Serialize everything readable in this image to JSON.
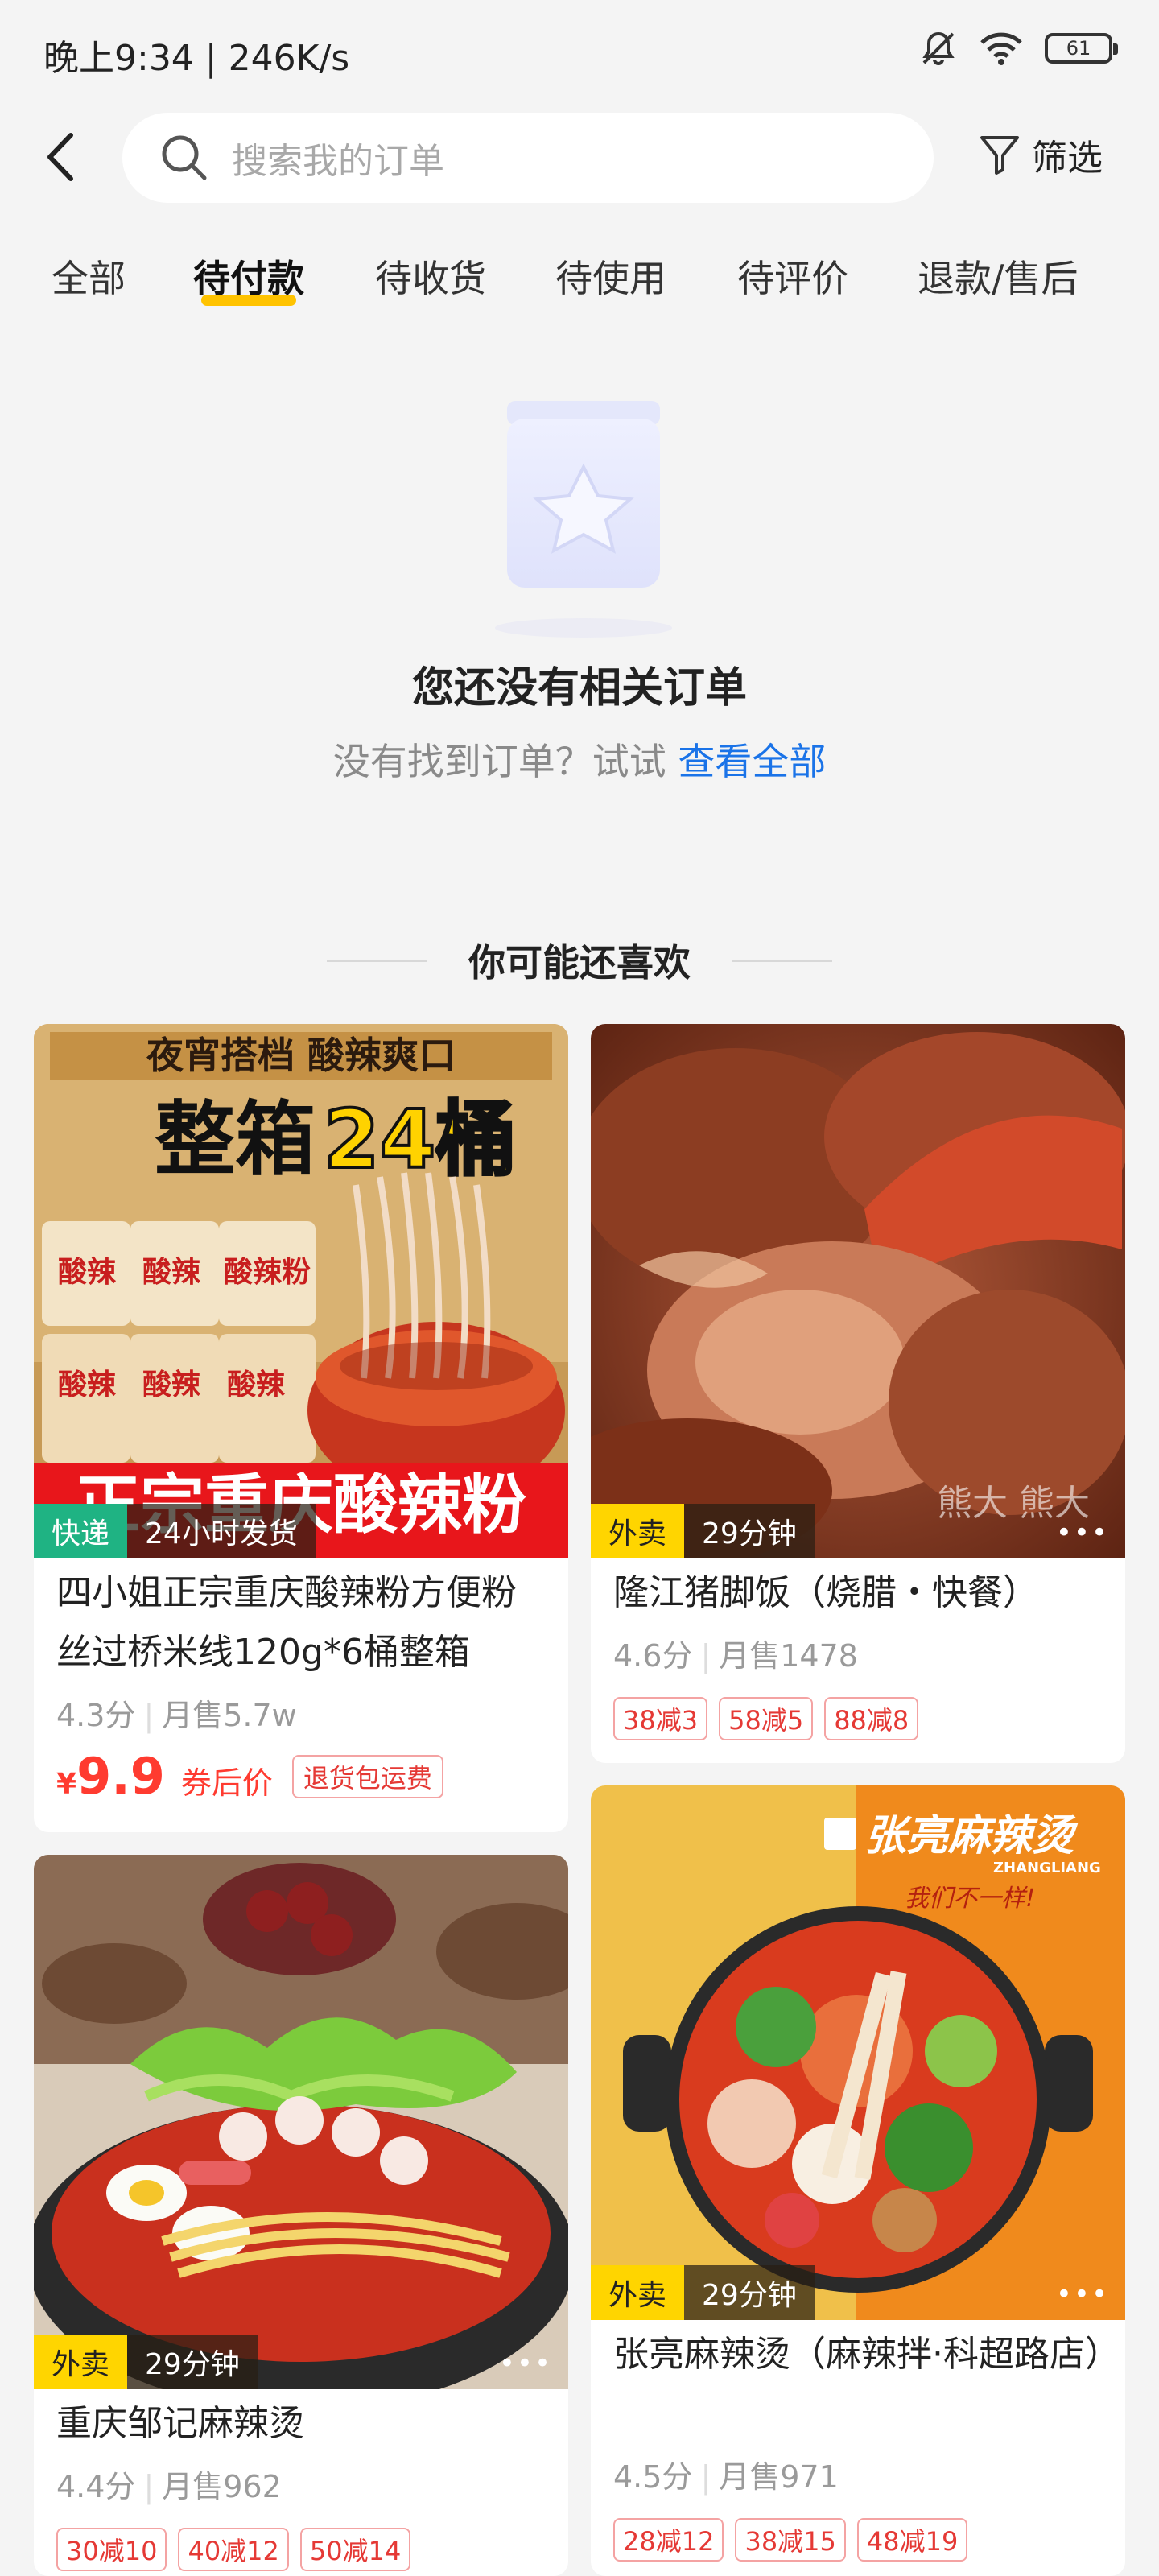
{
  "status_bar": {
    "time": "晚上9:34 | 246K/s",
    "battery": "61",
    "icons": [
      "mute-bell-icon",
      "wifi-icon",
      "battery-icon"
    ]
  },
  "header": {
    "back_icon": "chevron-left-icon",
    "search": {
      "placeholder": "搜索我的订单",
      "icon": "search-icon"
    },
    "filter_label": "筛选",
    "filter_icon": "funnel-icon"
  },
  "tabs": [
    {
      "label": "全部",
      "active": false
    },
    {
      "label": "待付款",
      "active": true
    },
    {
      "label": "待收货",
      "active": false
    },
    {
      "label": "待使用",
      "active": false
    },
    {
      "label": "待评价",
      "active": false
    },
    {
      "label": "退款/售后",
      "active": false
    }
  ],
  "empty_state": {
    "title": "您还没有相关订单",
    "subtitle": "没有找到订单？试试",
    "link": "查看全部"
  },
  "recommend": {
    "heading": "你可能还喜欢",
    "cards": [
      {
        "image_text_top": "夜宵搭档  酸辣爽口",
        "image_text_big": "整箱",
        "image_text_num": "24桶",
        "image_cup_label": "酸辣粉",
        "image_text_bottom": "正宗重庆酸辣粉",
        "tag_a": "快递",
        "tag_b": "24小时发货",
        "title": "四小姐正宗重庆酸辣粉方便粉丝过桥米线120g*6桶整箱",
        "rating": "4.3分",
        "sales": "月售5.7w",
        "price_symbol": "¥",
        "price": "9.9",
        "price_note": "券后价",
        "price_badge": "退货包运费"
      },
      {
        "image_watermark": "熊大 熊大",
        "tag_a": "外卖",
        "tag_b": "29分钟",
        "title": "隆江猪脚饭（烧腊・快餐）",
        "rating": "4.6分",
        "sales": "月售1478",
        "promos": [
          "38减3",
          "58减5",
          "88减8"
        ]
      },
      {
        "tag_a": "外卖",
        "tag_b": "29分钟",
        "title": "重庆邹记麻辣烫",
        "rating": "4.4分",
        "sales": "月售962",
        "promos": [
          "30减10",
          "40减12",
          "50减14"
        ]
      },
      {
        "image_brand": "张亮麻辣烫",
        "image_brand_en": "ZHANGLIANG",
        "image_slogan": "我们不一样!",
        "tag_a": "外卖",
        "tag_b": "29分钟",
        "title": "张亮麻辣烫（麻辣拌·科超路店）",
        "rating": "4.5分",
        "sales": "月售971",
        "promos": [
          "28减12",
          "38减15",
          "48减19"
        ]
      }
    ]
  }
}
